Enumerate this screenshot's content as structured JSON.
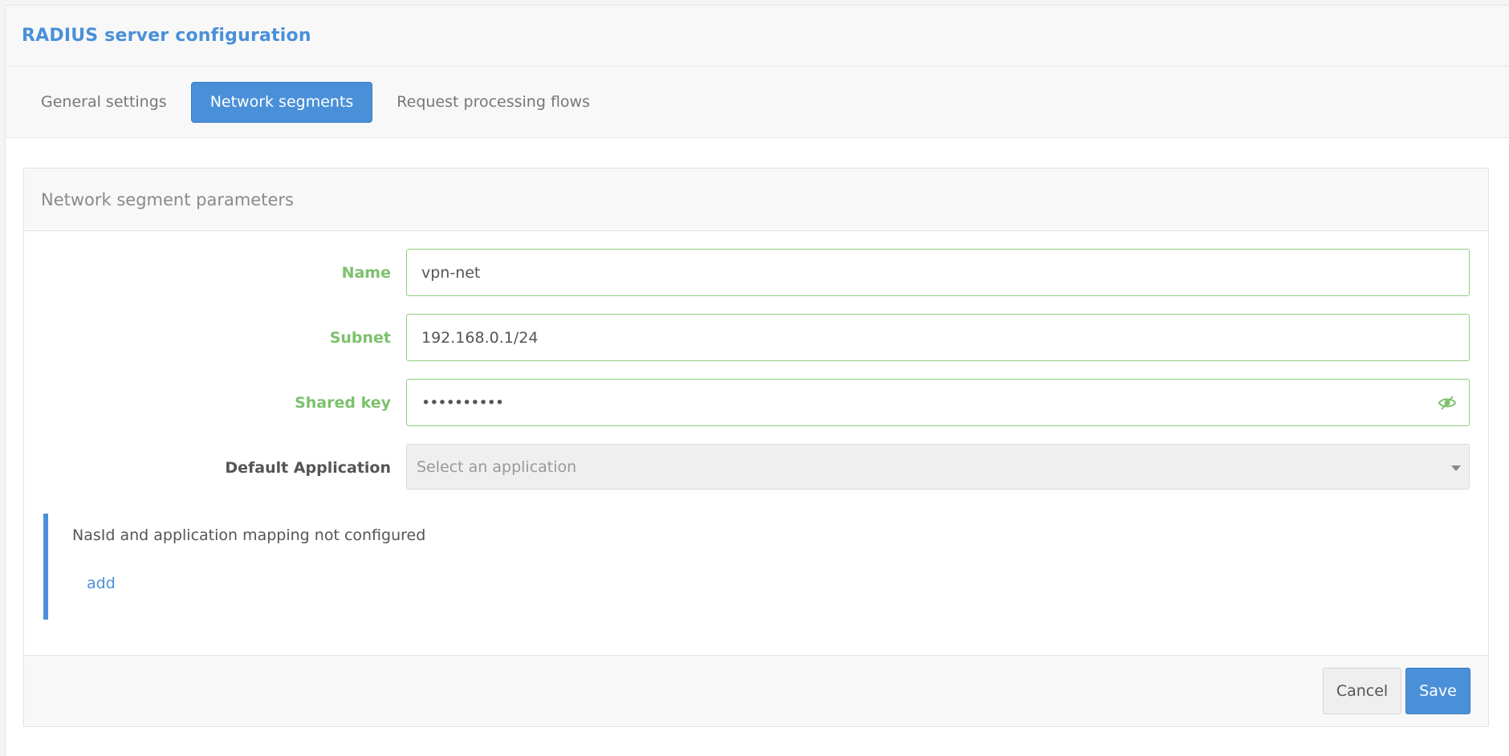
{
  "header": {
    "title": "RADIUS server configuration"
  },
  "tabs": [
    {
      "label": "General settings",
      "active": false
    },
    {
      "label": "Network segments",
      "active": true
    },
    {
      "label": "Request processing flows",
      "active": false
    }
  ],
  "panel": {
    "title": "Network segment parameters",
    "fields": {
      "name": {
        "label": "Name",
        "value": "vpn-net"
      },
      "subnet": {
        "label": "Subnet",
        "value": "192.168.0.1/24"
      },
      "shared_key": {
        "label": "Shared key",
        "value": "••••••••••",
        "icon": "eye-toggle-icon"
      },
      "default_application": {
        "label": "Default Application",
        "placeholder": "Select an application"
      }
    },
    "mapping": {
      "message": "NasId and application mapping not configured",
      "add_label": "add"
    },
    "footer": {
      "cancel_label": "Cancel",
      "save_label": "Save"
    }
  },
  "colors": {
    "accent": "#4a90d9",
    "valid_green": "#7cc16c",
    "muted_text": "#8a8a8a"
  }
}
